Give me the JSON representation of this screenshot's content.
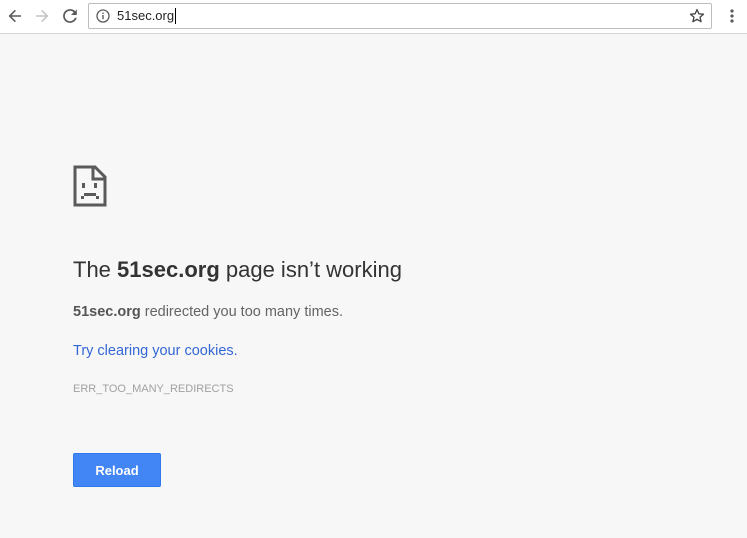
{
  "browser": {
    "url": "51sec.org",
    "icons": {
      "back": "arrow-left-icon",
      "forward": "arrow-right-icon",
      "reload": "reload-icon",
      "info": "info-icon",
      "bookmark": "star-icon",
      "menu": "kebab-menu-icon"
    }
  },
  "error_page": {
    "icon": "sad-document-icon",
    "headline_prefix": "The ",
    "headline_domain": "51sec.org",
    "headline_suffix": " page isn’t working",
    "desc_domain": "51sec.org",
    "desc_text": " redirected you too many times.",
    "suggestion": "Try clearing your cookies.",
    "error_code": "ERR_TOO_MANY_REDIRECTS",
    "reload_label": "Reload"
  },
  "colors": {
    "page_background": "#f7f7f7",
    "link": "#3367d6",
    "button": "#4285f4"
  }
}
